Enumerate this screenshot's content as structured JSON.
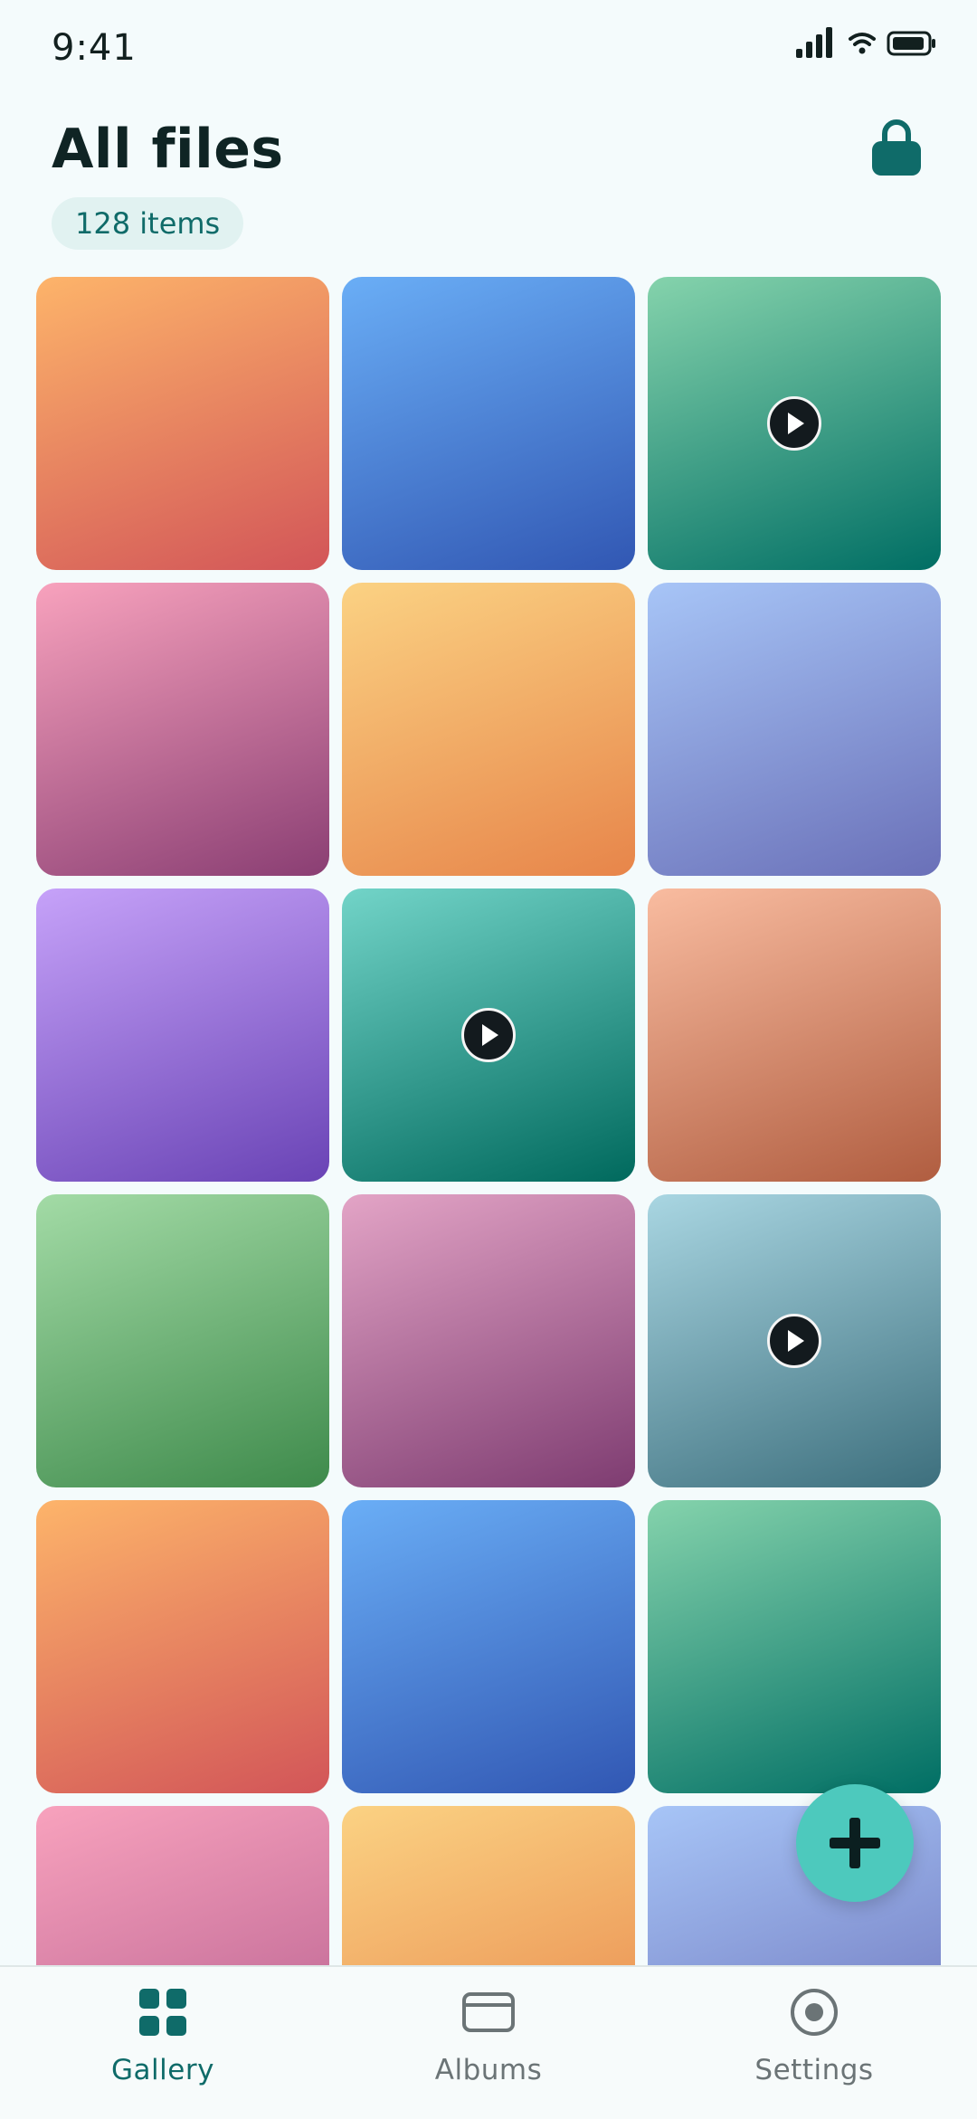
{
  "status": {
    "time": "9:41"
  },
  "header": {
    "title": "All files",
    "count": "128 items"
  },
  "colors": {
    "accent": "#0f6b69",
    "fab": "#4dc9bd",
    "inactive": "#6b7476"
  },
  "tiles": [
    {
      "g": [
        "#fdb46a",
        "#d25558"
      ],
      "video": false
    },
    {
      "g": [
        "#6aaef6",
        "#3157b3"
      ],
      "video": false
    },
    {
      "g": [
        "#85d3ac",
        "#006e64"
      ],
      "video": true
    },
    {
      "g": [
        "#f8a2bd",
        "#8a3e73"
      ],
      "video": false
    },
    {
      "g": [
        "#fbd283",
        "#e7854a"
      ],
      "video": false
    },
    {
      "g": [
        "#a7c5f7",
        "#6a70b8"
      ],
      "video": false
    },
    {
      "g": [
        "#c6a2f9",
        "#6943b5"
      ],
      "video": false
    },
    {
      "g": [
        "#72d4c8",
        "#00695d"
      ],
      "video": true
    },
    {
      "g": [
        "#f9bca0",
        "#b05d40"
      ],
      "video": false
    },
    {
      "g": [
        "#a3dba6",
        "#3e8a4b"
      ],
      "video": false
    },
    {
      "g": [
        "#e3a4c6",
        "#7e3c71"
      ],
      "video": false
    },
    {
      "g": [
        "#a9d6e2",
        "#3d6f7d"
      ],
      "video": true
    },
    {
      "g": [
        "#fdb46a",
        "#d25558"
      ],
      "video": false
    },
    {
      "g": [
        "#6aaef6",
        "#3157b3"
      ],
      "video": false
    },
    {
      "g": [
        "#85d3ac",
        "#006e64"
      ],
      "video": false
    },
    {
      "g": [
        "#f8a2bd",
        "#b55e8e"
      ],
      "video": false
    },
    {
      "g": [
        "#fbd283",
        "#e7854a"
      ],
      "video": false
    },
    {
      "g": [
        "#a7c5f7",
        "#6a70b8"
      ],
      "video": false
    }
  ],
  "nav": {
    "gallery": "Gallery",
    "albums": "Albums",
    "settings": "Settings"
  },
  "icons": {
    "lock": "lock-icon",
    "play": "play-icon",
    "add": "plus-icon",
    "gallery": "grid-icon",
    "albums": "card-icon",
    "settings": "radio-icon"
  }
}
